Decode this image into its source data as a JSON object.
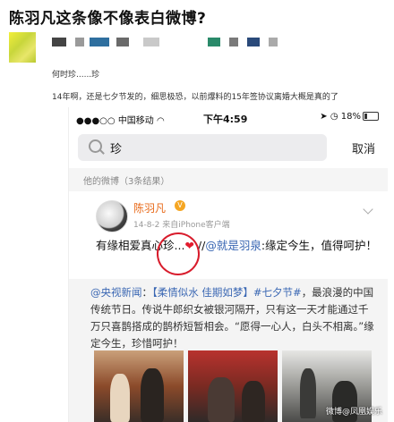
{
  "article": {
    "title": "陈羽凡这条像不像表白微博?",
    "post_line1": "何时珍......珍",
    "post_line2": "14年啊，还是七夕节发的，细思极恐，以前爆料的15年签协议离婚大概是真的了"
  },
  "phone": {
    "status": {
      "carrier": "中国移动",
      "time": "下午4:59",
      "battery": "18%"
    },
    "search": {
      "query": "珍",
      "cancel_label": "取消"
    },
    "section_label": "他的微博（3条结果）",
    "post": {
      "author": "陈羽凡",
      "meta": "14-8-2  来自iPhone客户端",
      "text_a": "有缘相爱真心珍...",
      "heart": "❤",
      "text_b": " //",
      "mention": "@就是羽泉",
      "text_c": ":缘定今生，值得呵护！"
    },
    "repost": {
      "source": "@央视新闻",
      "tag1": "【柔情似水 佳期如梦】",
      "hashtag": "#七夕节#",
      "body": "，最浪漫的中国传统节日。传说牛郎织女被银河隔开，只有这一天才能通过千万只喜鹊搭成的鹊桥短暂相会。“愿得一心人，白头不相离。”缘定今生，珍惜呵护！"
    },
    "watermark": "微博@凤凰娱乐"
  },
  "colors": {
    "accent_orange": "#e86a1a",
    "link_blue": "#3a67b3",
    "heart_red": "#e21b2e"
  }
}
